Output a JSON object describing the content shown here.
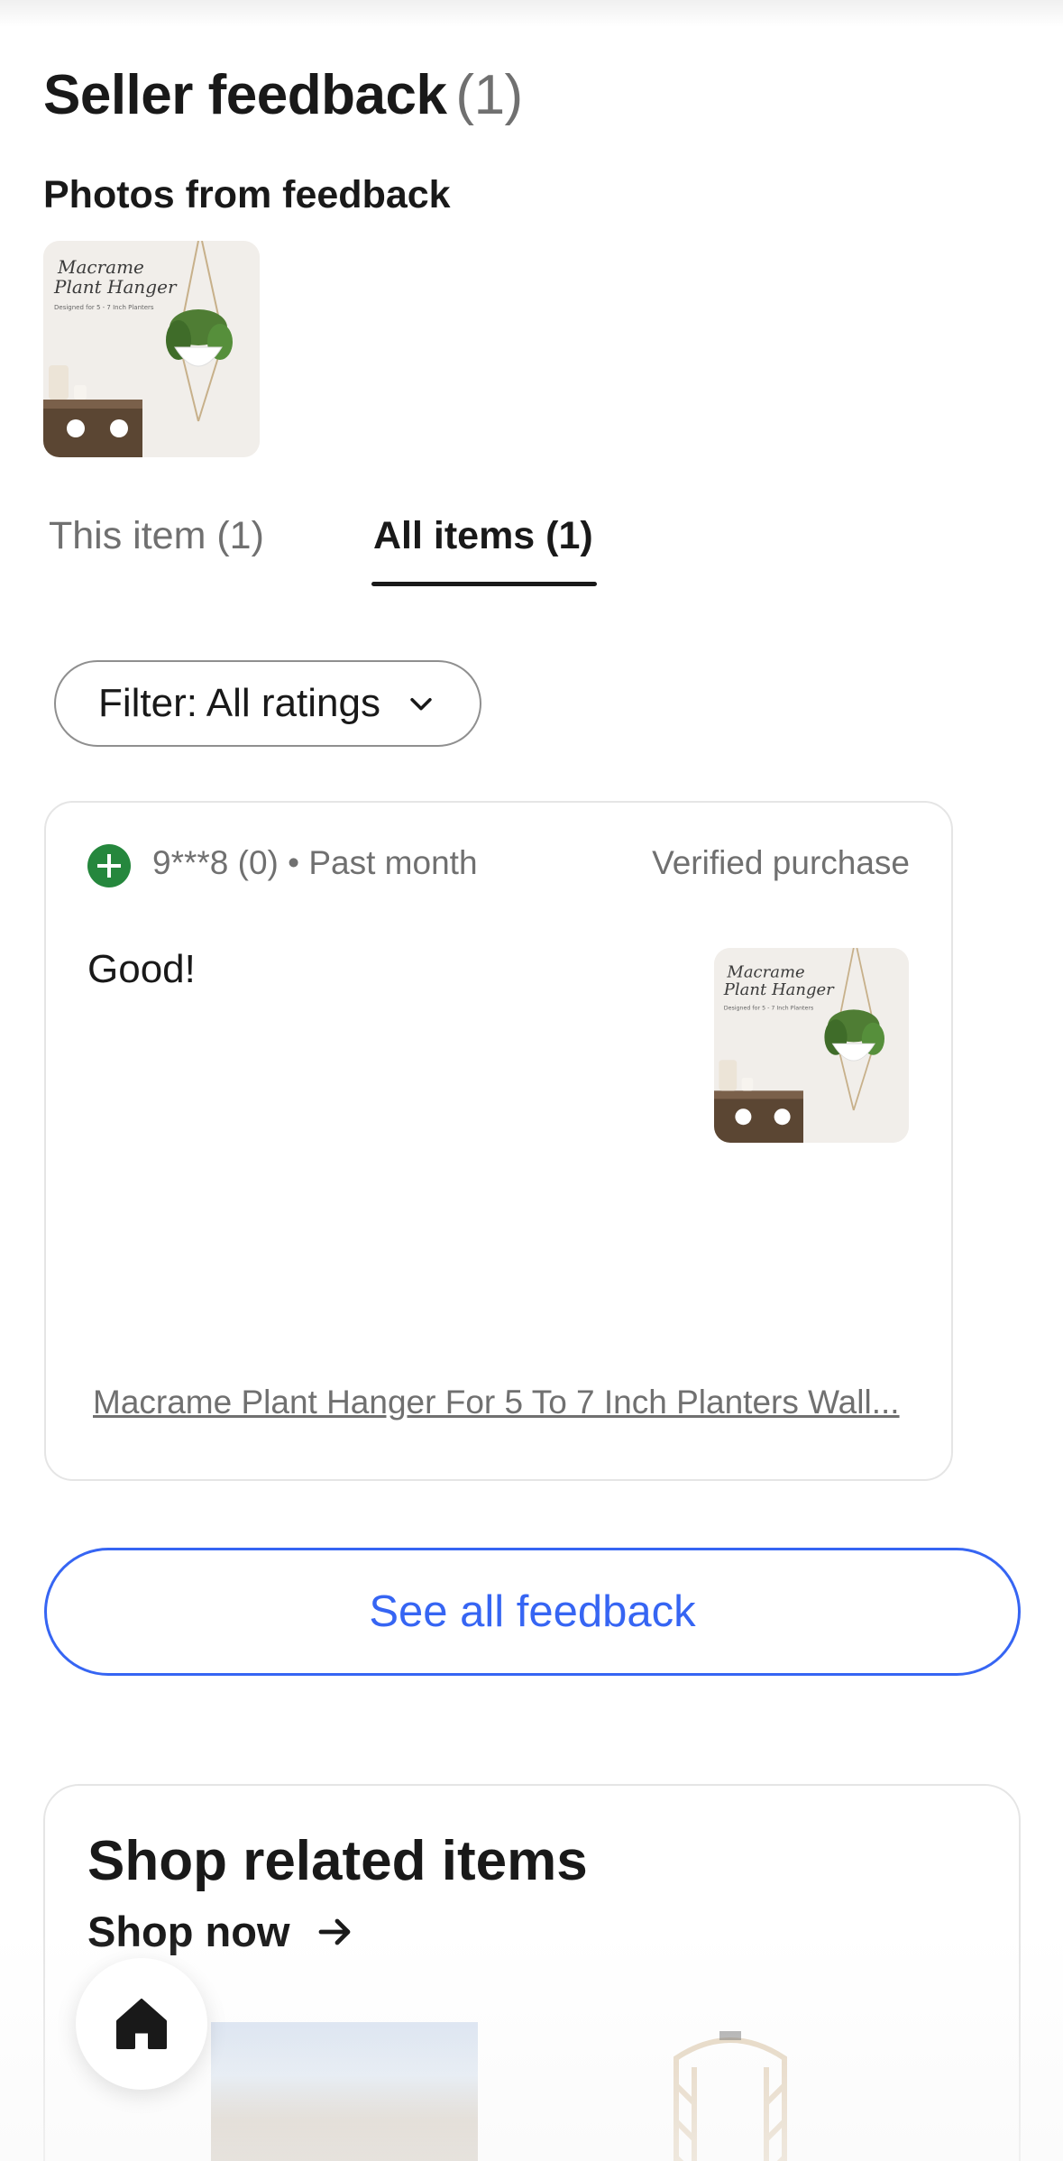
{
  "header": {
    "title": "Seller feedback",
    "title_count": "(1)"
  },
  "photos": {
    "label": "Photos from feedback",
    "thumb_alt_lines": [
      "Macrame",
      "Plant Hanger",
      "Designed for 5 - 7 Inch Planters"
    ]
  },
  "tabs": [
    {
      "label": "This item (1)",
      "selected": false
    },
    {
      "label": "All items (1)",
      "selected": true
    }
  ],
  "filter": {
    "label": "Filter: All ratings",
    "icon": "chevron-down-icon"
  },
  "review": {
    "rating_icon": "positive-plus-icon",
    "reviewer": "9***8 (0) • Past month",
    "verified": "Verified purchase",
    "text": "Good!",
    "item_link": "Macrame Plant Hanger For 5 To 7 Inch Planters Wall..."
  },
  "see_all": {
    "label": "See all feedback"
  },
  "related": {
    "title": "Shop related items",
    "shop_now": "Shop now",
    "arrow_icon": "arrow-right-icon"
  },
  "fab": {
    "icon": "home-icon"
  },
  "colors": {
    "accent_blue": "#3665f3",
    "positive_green": "#25873d",
    "text_primary": "#191919",
    "text_secondary": "#707070"
  }
}
